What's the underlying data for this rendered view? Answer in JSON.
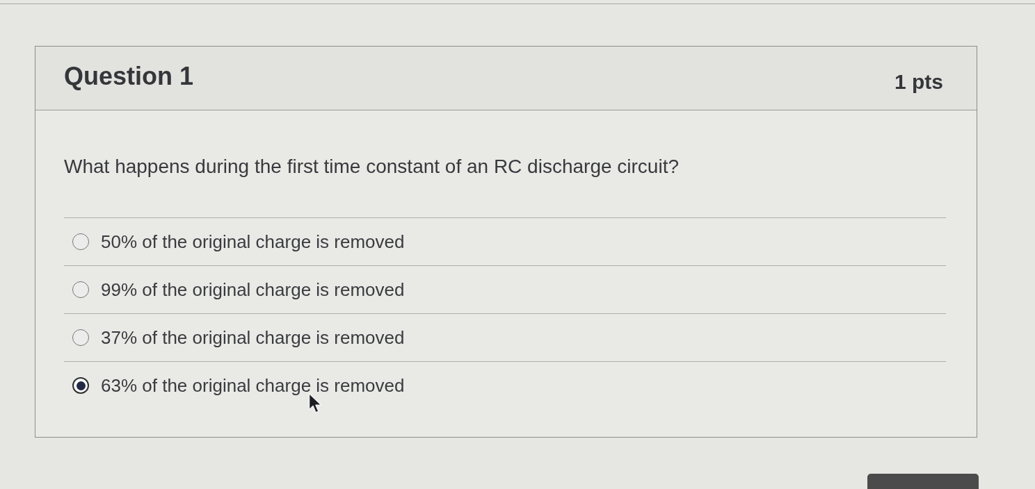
{
  "question": {
    "title": "Question 1",
    "points": "1 pts",
    "prompt": "What happens during the first time constant of an RC discharge circuit?",
    "options": [
      {
        "label": "50% of the original charge is removed",
        "selected": false
      },
      {
        "label": "99% of the original charge is removed",
        "selected": false
      },
      {
        "label": "37% of the original charge is removed",
        "selected": false
      },
      {
        "label": "63% of the original charge is removed",
        "selected": true
      }
    ]
  }
}
